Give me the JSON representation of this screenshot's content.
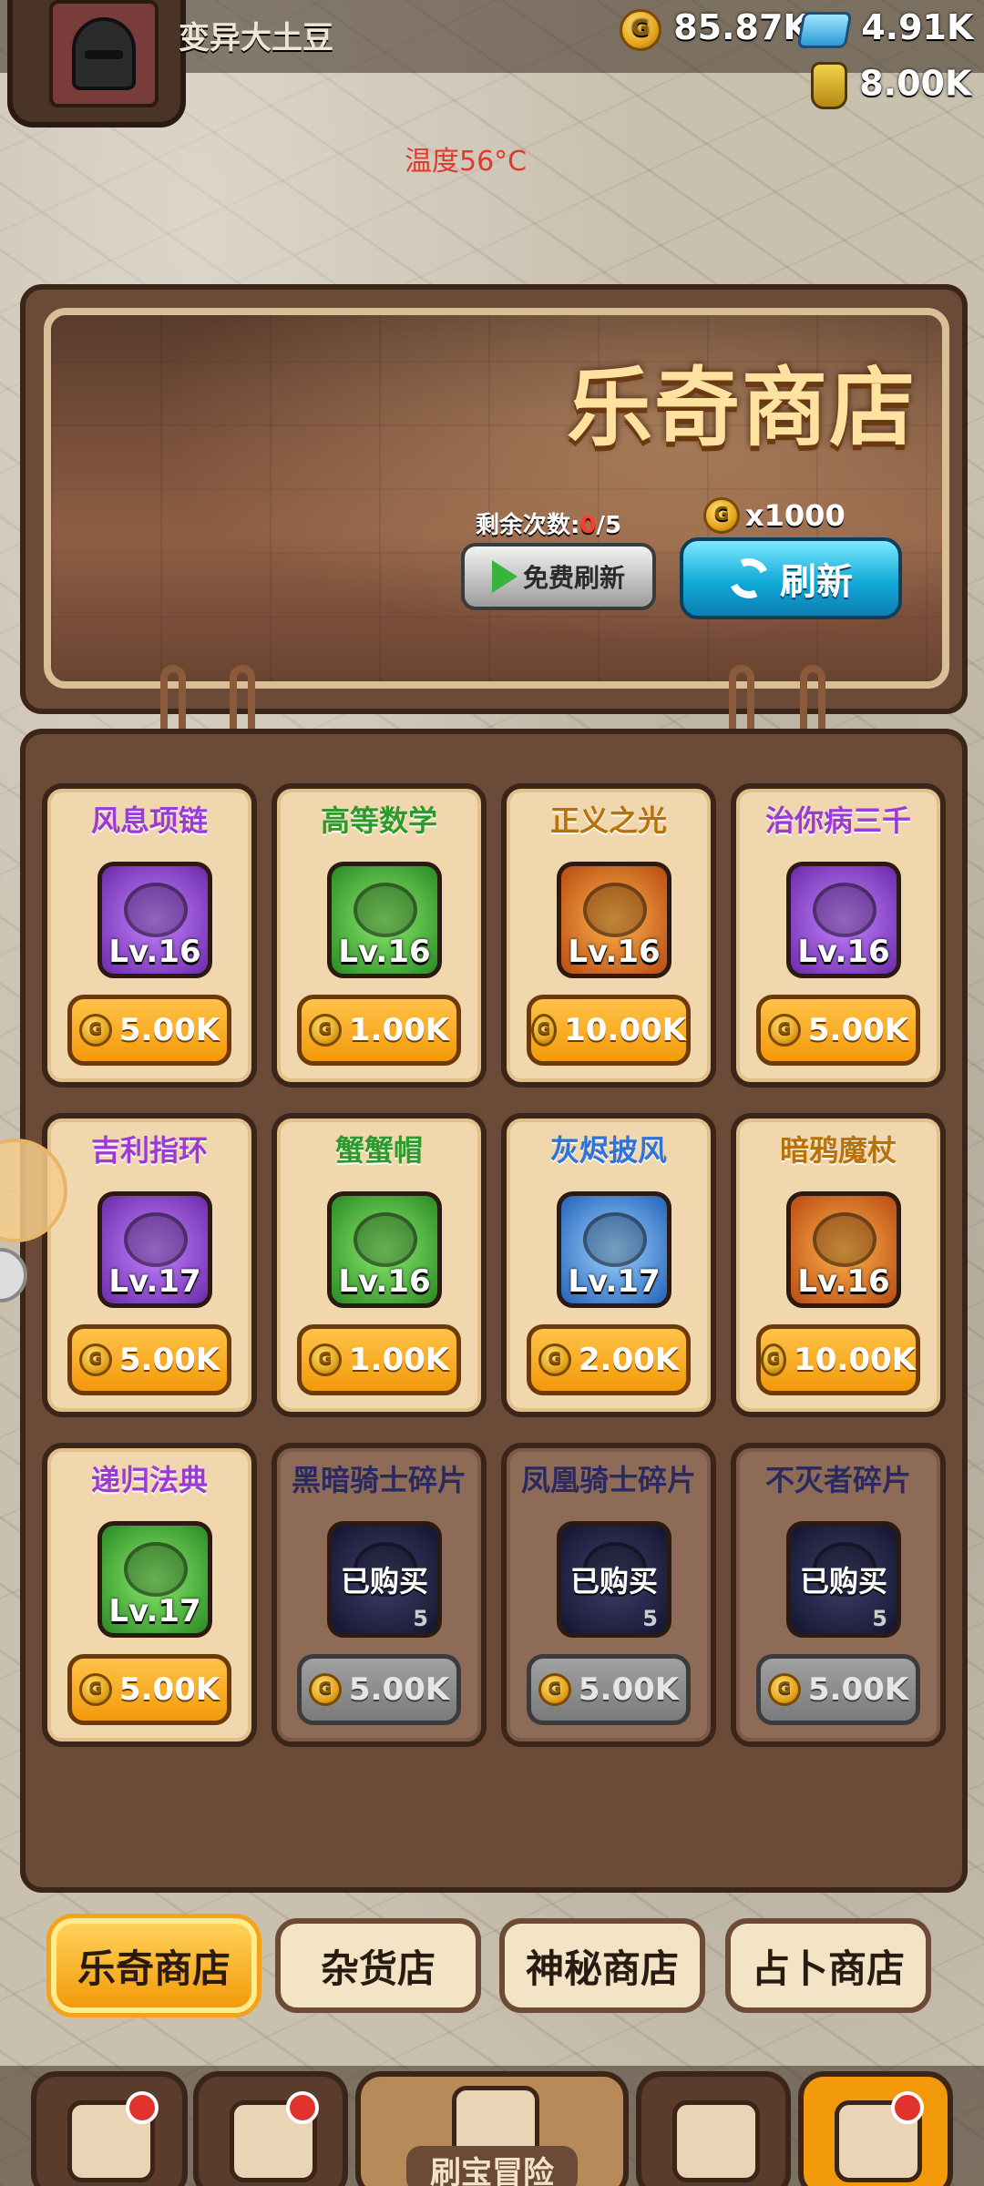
{
  "header": {
    "player_name": "变异大土豆",
    "gold": "85.87K",
    "gems": "4.91K",
    "potion": "8.00K",
    "temperature": "温度56°C"
  },
  "banner": {
    "title": "乐奇商店",
    "remaining_label": "剩余次数:",
    "remaining_used": "0",
    "remaining_total": "/5",
    "refresh_cost": "x1000",
    "free_refresh_label": "免费刷新",
    "refresh_label": "刷新"
  },
  "items": [
    {
      "name": "风息项链",
      "name_color": "#9b3bd7",
      "rarity": "purple",
      "level": "Lv.16",
      "price": "5.00K",
      "bought": false
    },
    {
      "name": "高等数学",
      "name_color": "#2f9a2a",
      "rarity": "green",
      "level": "Lv.16",
      "price": "1.00K",
      "bought": false
    },
    {
      "name": "正义之光",
      "name_color": "#b8720a",
      "rarity": "orange",
      "level": "Lv.16",
      "price": "10.00K",
      "bought": false
    },
    {
      "name": "治你病三千",
      "name_color": "#9b3bd7",
      "rarity": "purple",
      "level": "Lv.16",
      "price": "5.00K",
      "bought": false
    },
    {
      "name": "吉利指环",
      "name_color": "#9b3bd7",
      "rarity": "purple",
      "level": "Lv.17",
      "price": "5.00K",
      "bought": false
    },
    {
      "name": "蟹蟹帽",
      "name_color": "#2f9a2a",
      "rarity": "green",
      "level": "Lv.16",
      "price": "1.00K",
      "bought": false
    },
    {
      "name": "灰烬披风",
      "name_color": "#2f72d8",
      "rarity": "blue",
      "level": "Lv.17",
      "price": "2.00K",
      "bought": false
    },
    {
      "name": "暗鸦魔杖",
      "name_color": "#b8720a",
      "rarity": "orange",
      "level": "Lv.16",
      "price": "10.00K",
      "bought": false
    },
    {
      "name": "递归法典",
      "name_color": "#9b3bd7",
      "rarity": "green",
      "level": "Lv.17",
      "price": "5.00K",
      "bought": false
    },
    {
      "name": "黑暗骑士碎片",
      "name_color": "#2a2a60",
      "rarity": "dark",
      "level": "",
      "bought_label": "已购买",
      "count": "5",
      "price": "5.00K",
      "bought": true
    },
    {
      "name": "凤凰骑士碎片",
      "name_color": "#2a2a60",
      "rarity": "dark",
      "level": "",
      "bought_label": "已购买",
      "count": "5",
      "price": "5.00K",
      "bought": true
    },
    {
      "name": "不灭者碎片",
      "name_color": "#2a2a60",
      "rarity": "dark",
      "level": "",
      "bought_label": "已购买",
      "count": "5",
      "price": "5.00K",
      "bought": true
    }
  ],
  "tabs": [
    "乐奇商店",
    "杂货店",
    "神秘商店",
    "占卜商店"
  ],
  "bottom_nav": {
    "center_label": "刷宝冒险"
  }
}
